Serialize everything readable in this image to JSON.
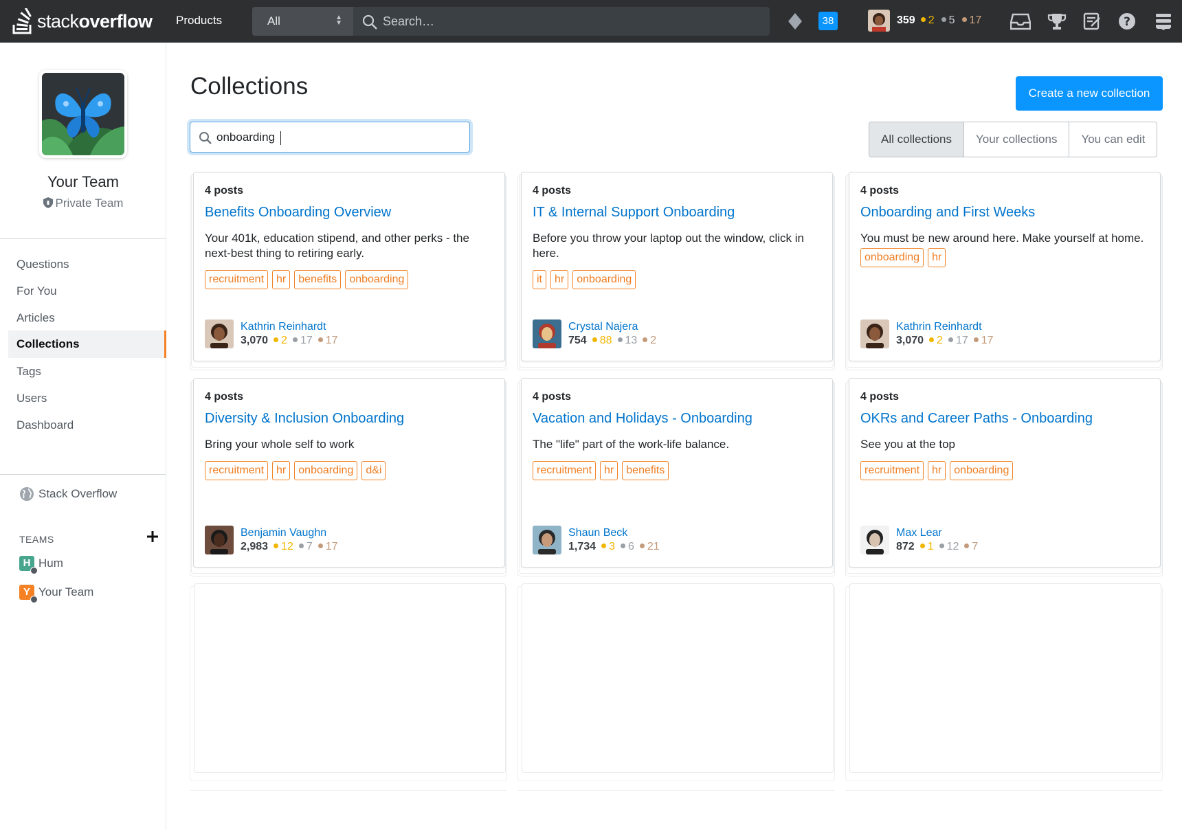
{
  "topbar": {
    "logo_text_1": "stack",
    "logo_text_2": "overflow",
    "products": "Products",
    "scope": "All",
    "search_placeholder": "Search…",
    "inbox_count": "38",
    "user": {
      "rep": "359",
      "gold": "2",
      "silver": "5",
      "bronze": "17"
    }
  },
  "sidebar": {
    "team_name": "Your Team",
    "team_type": "Private Team",
    "nav": [
      "Questions",
      "For You",
      "Articles",
      "Collections",
      "Tags",
      "Users",
      "Dashboard"
    ],
    "active": "Collections",
    "stack_overflow": "Stack Overflow",
    "teams_header": "TEAMS",
    "teams": [
      {
        "initial": "H",
        "name": "Hum",
        "color": "#48a68e"
      },
      {
        "initial": "Y",
        "name": "Your Team",
        "color": "#f48225"
      }
    ]
  },
  "main": {
    "title": "Collections",
    "create_button": "Create a new collection",
    "filter_value": "onboarding ",
    "tabs": [
      "All collections",
      "Your collections",
      "You can edit"
    ],
    "selected_tab": "All collections",
    "cards": [
      {
        "posts": "4 posts",
        "title": "Benefits Onboarding Overview",
        "description": "Your 401k, education stipend, and other perks - the next-best thing to retiring early.",
        "tags": [
          "recruitment",
          "hr",
          "benefits",
          "onboarding"
        ],
        "author": {
          "name": "Kathrin Reinhardt",
          "rep": "3,070",
          "gold": "2",
          "silver": "17",
          "bronze": "17"
        }
      },
      {
        "posts": "4 posts",
        "title": "IT & Internal Support Onboarding",
        "description": "Before you throw your laptop out the window, click in here.",
        "tags": [
          "it",
          "hr",
          "onboarding"
        ],
        "author": {
          "name": "Crystal Najera",
          "rep": "754",
          "gold": "88",
          "silver": "13",
          "bronze": "2"
        }
      },
      {
        "posts": "4 posts",
        "title": "Onboarding and First Weeks",
        "description": "You must be new around here. Make yourself at home.",
        "tags": [
          "onboarding",
          "hr"
        ],
        "author": {
          "name": "Kathrin Reinhardt",
          "rep": "3,070",
          "gold": "2",
          "silver": "17",
          "bronze": "17"
        }
      },
      {
        "posts": "4 posts",
        "title": "Diversity & Inclusion Onboarding",
        "description": "Bring your whole self to work",
        "tags": [
          "recruitment",
          "hr",
          "onboarding",
          "d&i"
        ],
        "author": {
          "name": "Benjamin Vaughn",
          "rep": "2,983",
          "gold": "12",
          "silver": "7",
          "bronze": "17"
        }
      },
      {
        "posts": "4 posts",
        "title": "Vacation and Holidays - Onboarding",
        "description": "The \"life\" part of the work-life balance.",
        "tags": [
          "recruitment",
          "hr",
          "benefits"
        ],
        "author": {
          "name": "Shaun Beck",
          "rep": "1,734",
          "gold": "3",
          "silver": "6",
          "bronze": "21"
        }
      },
      {
        "posts": "4 posts",
        "title": "OKRs and Career Paths - Onboarding",
        "description": "See you at the top",
        "tags": [
          "recruitment",
          "hr",
          "onboarding"
        ],
        "author": {
          "name": "Max Lear",
          "rep": "872",
          "gold": "1",
          "silver": "12",
          "bronze": "7"
        }
      }
    ]
  },
  "colors": {
    "accent_blue": "#0a95ff",
    "link_blue": "#0074cc",
    "tag_orange": "#f48225",
    "topbar_bg": "#2d2f31"
  },
  "icons": [
    "stack-overflow-logo",
    "search-icon",
    "diamond-icon",
    "inbox-icon",
    "trophy-icon",
    "review-icon",
    "help-icon",
    "site-switcher-icon",
    "shield-icon",
    "globe-icon",
    "plus-icon"
  ]
}
